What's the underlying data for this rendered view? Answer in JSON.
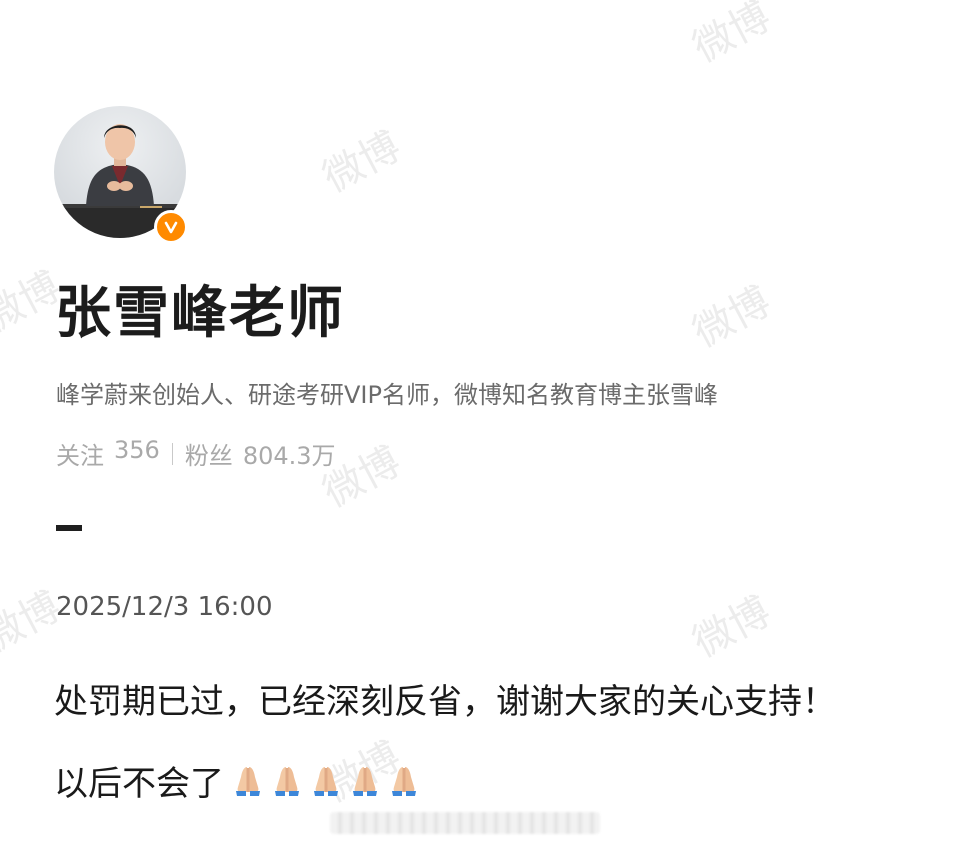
{
  "profile": {
    "name": "张雪峰老师",
    "bio": "峰学蔚来创始人、研途考研VIP名师，微博知名教育博主张雪峰",
    "stats": {
      "following_label": "关注",
      "following_value": "356",
      "fans_label": "粉丝",
      "fans_value": "804.3万"
    },
    "verified_badge": "orange-v-icon"
  },
  "post": {
    "date": "2025/12/3 16:00",
    "line1": "处罚期已过，已经深刻反省，谢谢大家的关心支持！",
    "line2": "以后不会了",
    "emoji": "pray-icon",
    "emoji_count": 5
  },
  "watermark": {
    "text": "微博"
  },
  "colors": {
    "badge": "#ff8a00",
    "name": "#1c1c1c",
    "bio": "#6b6b6b",
    "stats": "#a9a9a9"
  }
}
